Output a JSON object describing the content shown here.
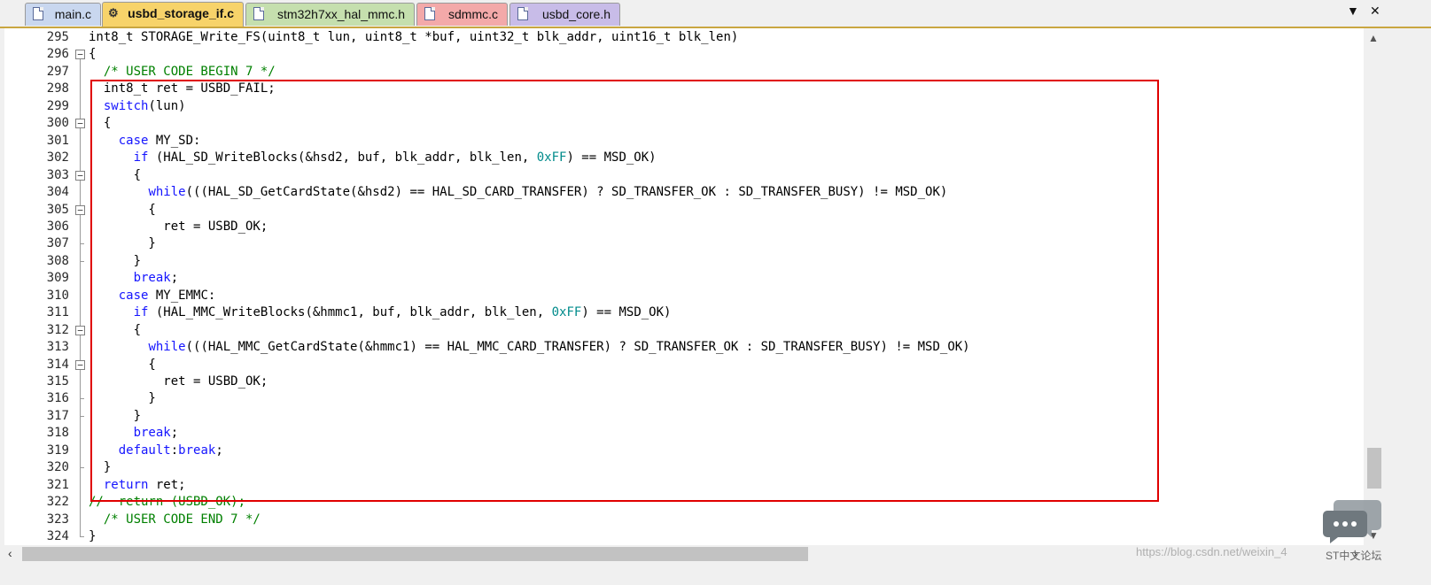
{
  "tabs": [
    {
      "label": "main.c",
      "color": "#c9d7ef",
      "active": false,
      "icon": "file-icon"
    },
    {
      "label": "usbd_storage_if.c",
      "color": "#f7d36a",
      "active": true,
      "icon": "gear-icon"
    },
    {
      "label": "stm32h7xx_hal_mmc.h",
      "color": "#c5dfae",
      "active": false,
      "icon": "file-icon"
    },
    {
      "label": "sdmmc.c",
      "color": "#f3a9a9",
      "active": false,
      "icon": "file-icon"
    },
    {
      "label": "usbd_core.h",
      "color": "#c8bce8",
      "active": false,
      "icon": "file-icon"
    }
  ],
  "tab_menu_glyph": "▼",
  "close_glyph": "✕",
  "lines": [
    {
      "n": "295",
      "fold": "none",
      "t": [
        [
          "plain",
          "int8_t STORAGE_Write_FS(uint8_t lun, uint8_t *buf, uint32_t blk_addr, uint16_t blk_len)"
        ]
      ]
    },
    {
      "n": "296",
      "fold": "open",
      "t": [
        [
          "plain",
          "{"
        ]
      ]
    },
    {
      "n": "297",
      "fold": "line",
      "t": [
        [
          "cm",
          "  /* USER CODE BEGIN 7 */"
        ]
      ]
    },
    {
      "n": "298",
      "fold": "line",
      "t": [
        [
          "plain",
          "  int8_t ret = USBD_FAIL;"
        ]
      ]
    },
    {
      "n": "299",
      "fold": "line",
      "t": [
        [
          "plain",
          "  "
        ],
        [
          "kw",
          "switch"
        ],
        [
          "plain",
          "(lun)"
        ]
      ]
    },
    {
      "n": "300",
      "fold": "open",
      "t": [
        [
          "plain",
          "  {"
        ]
      ]
    },
    {
      "n": "301",
      "fold": "line",
      "t": [
        [
          "plain",
          "    "
        ],
        [
          "kw",
          "case"
        ],
        [
          "plain",
          " MY_SD:"
        ]
      ]
    },
    {
      "n": "302",
      "fold": "line",
      "t": [
        [
          "plain",
          "      "
        ],
        [
          "kw",
          "if"
        ],
        [
          "plain",
          " (HAL_SD_WriteBlocks(&hsd2, buf, blk_addr, blk_len, "
        ],
        [
          "num",
          "0xFF"
        ],
        [
          "plain",
          ") == MSD_OK)"
        ]
      ]
    },
    {
      "n": "303",
      "fold": "open",
      "t": [
        [
          "plain",
          "      {"
        ]
      ]
    },
    {
      "n": "304",
      "fold": "line",
      "t": [
        [
          "plain",
          "        "
        ],
        [
          "kw",
          "while"
        ],
        [
          "plain",
          "(((HAL_SD_GetCardState(&hsd2) == HAL_SD_CARD_TRANSFER) ? SD_TRANSFER_OK : SD_TRANSFER_BUSY) != MSD_OK)"
        ]
      ]
    },
    {
      "n": "305",
      "fold": "open",
      "t": [
        [
          "plain",
          "        {"
        ]
      ]
    },
    {
      "n": "306",
      "fold": "line",
      "t": [
        [
          "plain",
          "          ret = USBD_OK;"
        ]
      ]
    },
    {
      "n": "307",
      "fold": "end",
      "t": [
        [
          "plain",
          "        }"
        ]
      ]
    },
    {
      "n": "308",
      "fold": "end",
      "t": [
        [
          "plain",
          "      }"
        ]
      ]
    },
    {
      "n": "309",
      "fold": "line",
      "t": [
        [
          "plain",
          "      "
        ],
        [
          "kw",
          "break"
        ],
        [
          "plain",
          ";"
        ]
      ]
    },
    {
      "n": "310",
      "fold": "line",
      "t": [
        [
          "plain",
          "    "
        ],
        [
          "kw",
          "case"
        ],
        [
          "plain",
          " MY_EMMC:"
        ]
      ]
    },
    {
      "n": "311",
      "fold": "line",
      "t": [
        [
          "plain",
          "      "
        ],
        [
          "kw",
          "if"
        ],
        [
          "plain",
          " (HAL_MMC_WriteBlocks(&hmmc1, buf, blk_addr, blk_len, "
        ],
        [
          "num",
          "0xFF"
        ],
        [
          "plain",
          ") == MSD_OK)"
        ]
      ]
    },
    {
      "n": "312",
      "fold": "open",
      "t": [
        [
          "plain",
          "      {"
        ]
      ]
    },
    {
      "n": "313",
      "fold": "line",
      "t": [
        [
          "plain",
          "        "
        ],
        [
          "kw",
          "while"
        ],
        [
          "plain",
          "(((HAL_MMC_GetCardState(&hmmc1) == HAL_MMC_CARD_TRANSFER) ? SD_TRANSFER_OK : SD_TRANSFER_BUSY) != MSD_OK)"
        ]
      ]
    },
    {
      "n": "314",
      "fold": "open",
      "t": [
        [
          "plain",
          "        {"
        ]
      ]
    },
    {
      "n": "315",
      "fold": "line",
      "t": [
        [
          "plain",
          "          ret = USBD_OK;"
        ]
      ]
    },
    {
      "n": "316",
      "fold": "end",
      "t": [
        [
          "plain",
          "        }"
        ]
      ]
    },
    {
      "n": "317",
      "fold": "end",
      "t": [
        [
          "plain",
          "      }"
        ]
      ]
    },
    {
      "n": "318",
      "fold": "line",
      "t": [
        [
          "plain",
          "      "
        ],
        [
          "kw",
          "break"
        ],
        [
          "plain",
          ";"
        ]
      ]
    },
    {
      "n": "319",
      "fold": "line",
      "t": [
        [
          "plain",
          "    "
        ],
        [
          "kw",
          "default"
        ],
        [
          "plain",
          ":"
        ],
        [
          "kw",
          "break"
        ],
        [
          "plain",
          ";"
        ]
      ]
    },
    {
      "n": "320",
      "fold": "end",
      "t": [
        [
          "plain",
          "  }"
        ]
      ]
    },
    {
      "n": "321",
      "fold": "line",
      "t": [
        [
          "plain",
          "  "
        ],
        [
          "kw",
          "return"
        ],
        [
          "plain",
          " ret;"
        ]
      ]
    },
    {
      "n": "322",
      "fold": "line",
      "t": [
        [
          "cm",
          "//  return (USBD_OK);"
        ]
      ]
    },
    {
      "n": "323",
      "fold": "line",
      "t": [
        [
          "cm",
          "  /* USER CODE END 7 */"
        ]
      ]
    },
    {
      "n": "324",
      "fold": "end",
      "t": [
        [
          "plain",
          "}"
        ]
      ]
    }
  ],
  "watermark": "https://blog.csdn.net/weixin_4",
  "watermark2": "ST中文论坛",
  "colors": {
    "keyword": "#1515ff",
    "number": "#008b8b",
    "comment": "#008000",
    "highlight_box": "#e00000"
  }
}
